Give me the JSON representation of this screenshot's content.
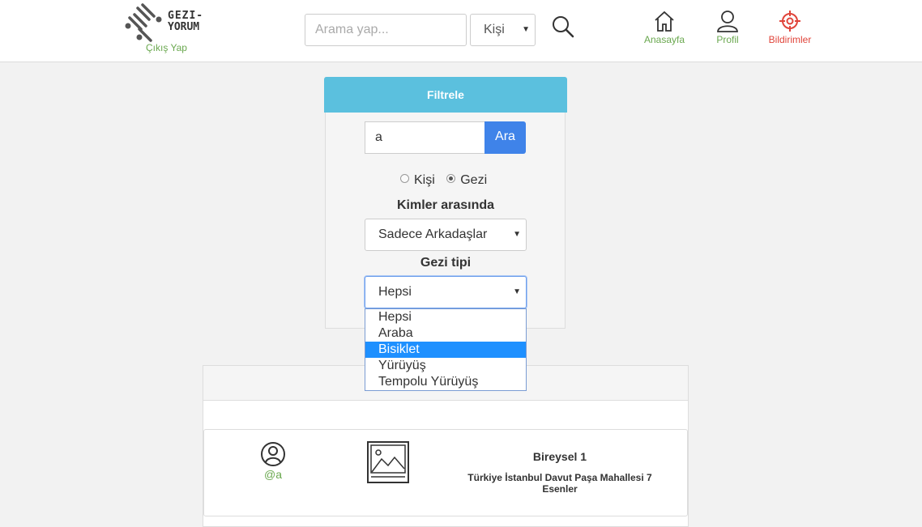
{
  "navbar": {
    "logo_line1": "GEZI-",
    "logo_line2": "YORUM",
    "logout_label": "Çıkış Yap",
    "search_placeholder": "Arama yap...",
    "search_type_selected": "Kişi",
    "search_icon": "search-icon",
    "items": [
      {
        "label": "Anasayfa",
        "icon": "home-icon"
      },
      {
        "label": "Profil",
        "icon": "user-icon"
      },
      {
        "label": "Bildirimler",
        "icon": "target-icon"
      }
    ],
    "colors": {
      "nav_label": "#6aa84f",
      "notifications": "#e0443a"
    }
  },
  "filter": {
    "title": "Filtrele",
    "query_value": "a",
    "search_button": "Ara",
    "type_options": [
      {
        "label": "Kişi",
        "checked": false
      },
      {
        "label": "Gezi",
        "checked": true
      }
    ],
    "audience_label": "Kimler arasında",
    "audience_selected": "Sadece Arkadaşlar",
    "trip_type_label": "Gezi tipi",
    "trip_type_selected": "Hepsi",
    "trip_type_options": [
      "Hepsi",
      "Araba",
      "Bisiklet",
      "Yürüyüş",
      "Tempolu Yürüyüş"
    ],
    "highlighted_option": "Bisiklet",
    "colors": {
      "header": "#5bc0de",
      "button": "#3f83e9",
      "highlight": "#1e90ff"
    }
  },
  "results": {
    "items": [
      {
        "username": "@a",
        "title": "Bireysel 1",
        "address": "Türkiye İstanbul Davut Paşa Mahallesi 7 Esenler"
      }
    ]
  }
}
